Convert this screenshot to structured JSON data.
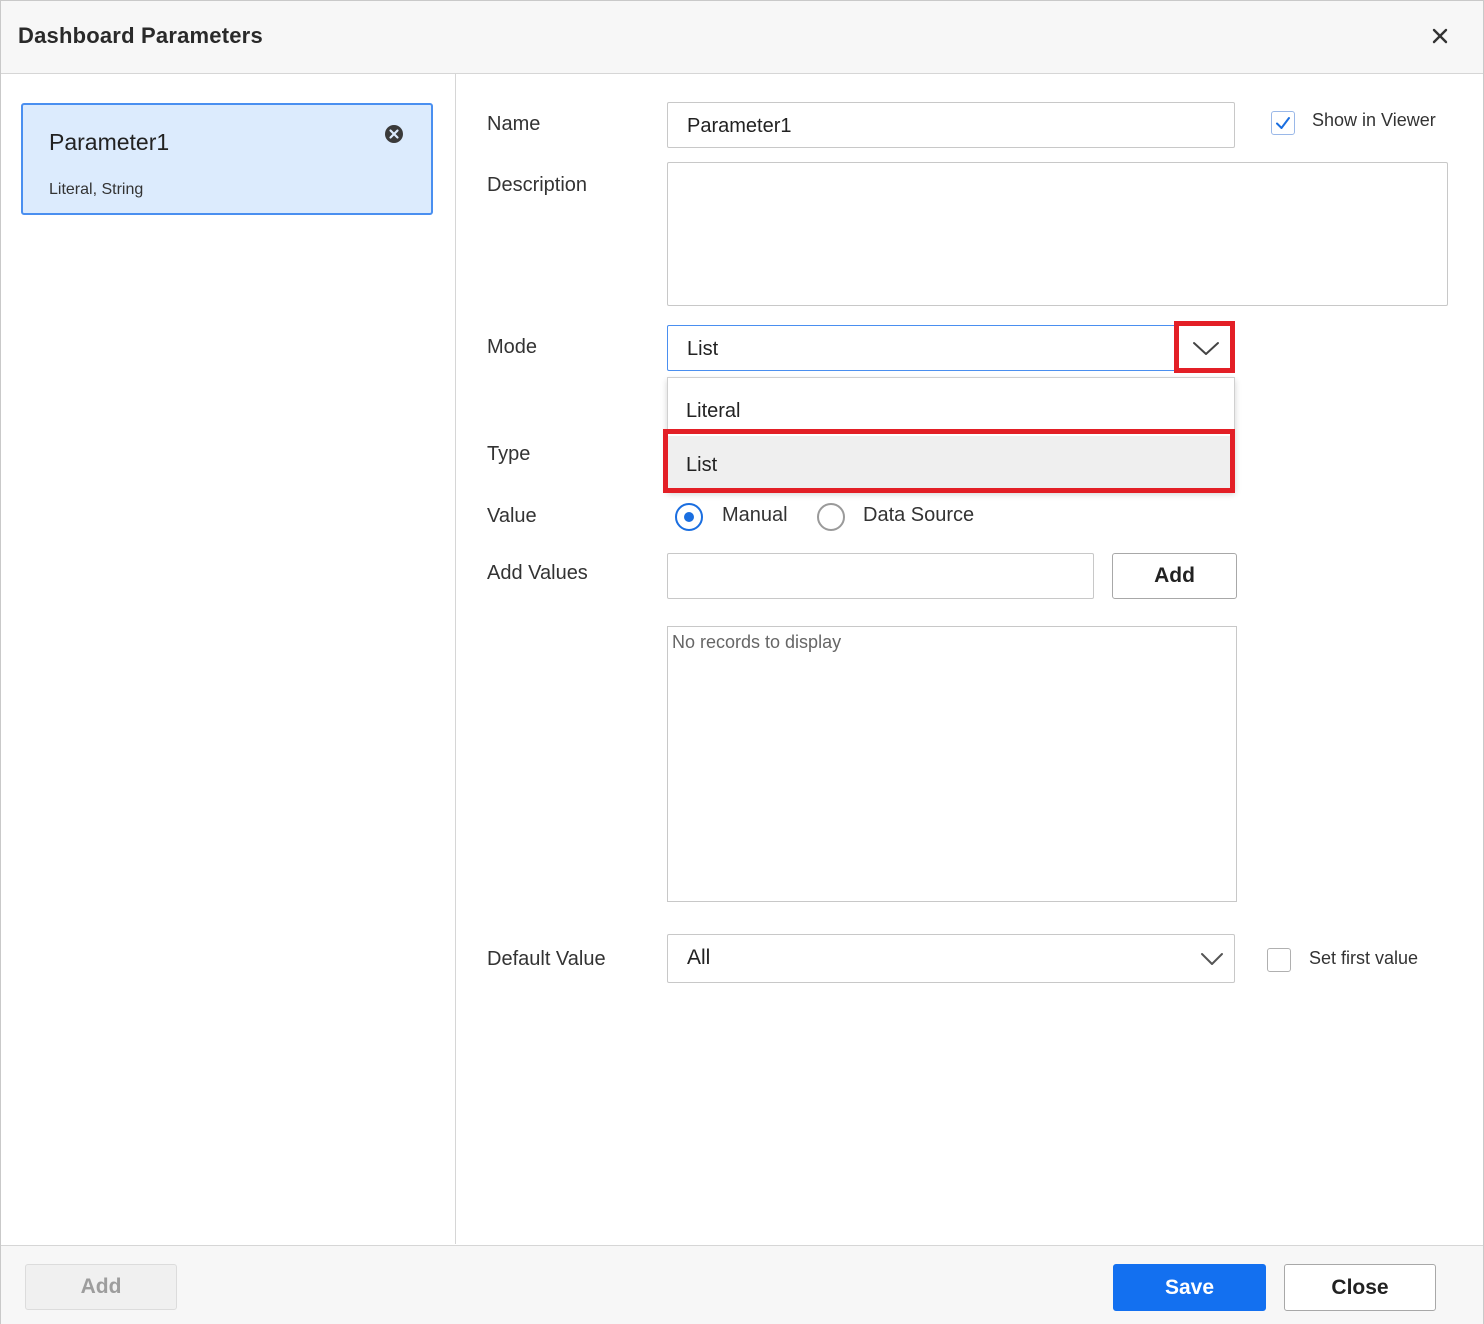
{
  "dialog": {
    "title": "Dashboard Parameters",
    "close_icon": "close-icon"
  },
  "parameters": [
    {
      "name": "Parameter1",
      "subtitle": "Literal, String",
      "remove_icon": "remove-circle-icon"
    }
  ],
  "form": {
    "name_label": "Name",
    "name_value": "Parameter1",
    "show_in_viewer_label": "Show in Viewer",
    "show_in_viewer_checked": true,
    "description_label": "Description",
    "description_value": "",
    "mode_label": "Mode",
    "mode_value": "List",
    "mode_options": [
      "Literal",
      "List"
    ],
    "type_label": "Type",
    "value_label": "Value",
    "value_options": [
      "Manual",
      "Data Source"
    ],
    "value_selected": "Manual",
    "add_values_label": "Add Values",
    "add_values_input": "",
    "add_button_label": "Add",
    "records_empty_text": "No records to display",
    "default_value_label": "Default Value",
    "default_value": "All",
    "set_first_value_label": "Set first value",
    "set_first_value_checked": false
  },
  "footer": {
    "add_label": "Add",
    "save_label": "Save",
    "close_label": "Close"
  },
  "colors": {
    "accent": "#1370f0",
    "highlight": "#e31f26",
    "selected_card": "#dcebfd"
  }
}
